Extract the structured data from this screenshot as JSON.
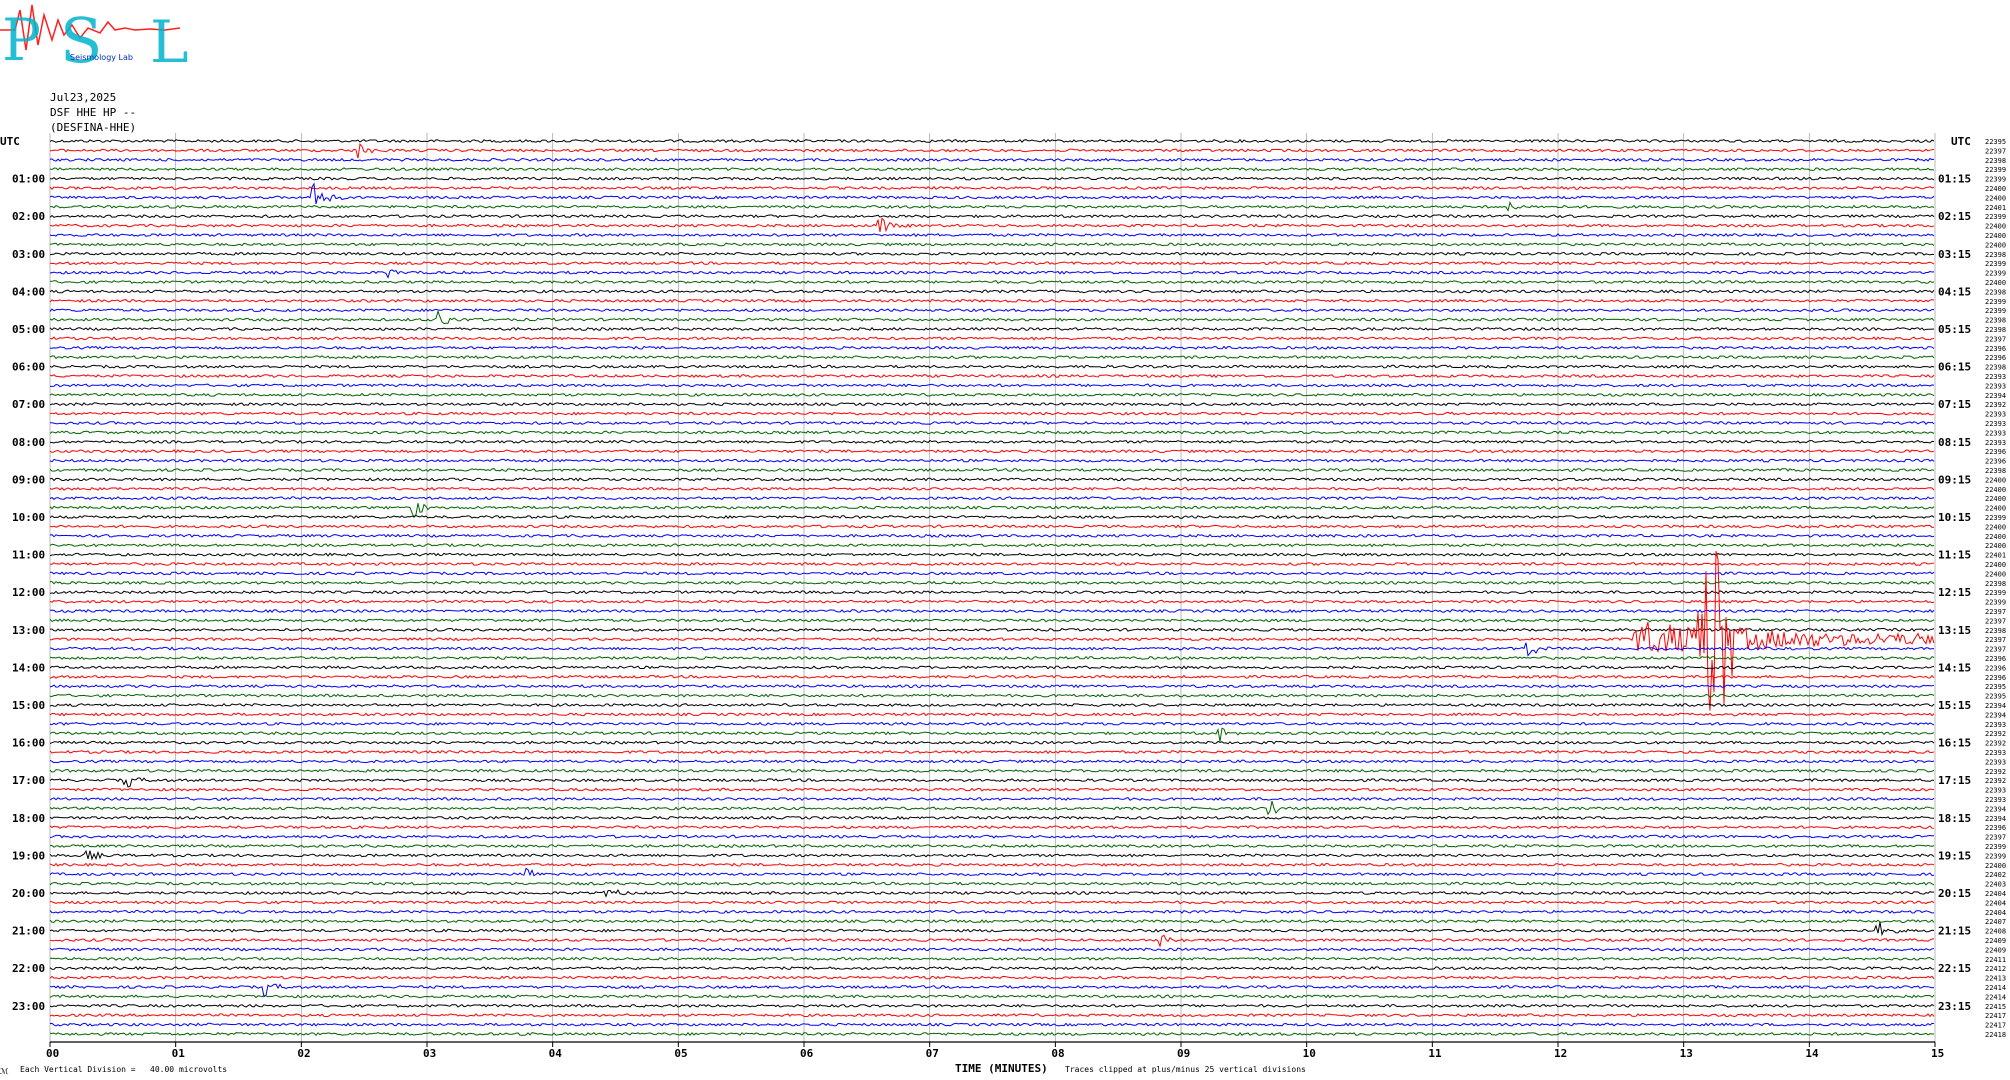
{
  "logo": {
    "letters": [
      "P",
      "S",
      "L"
    ],
    "subtitle": "Seismology Lab"
  },
  "header": {
    "date": "Jul23,2025",
    "channel": "DSF HHE HP --",
    "station": "(DESFINA-HHE)"
  },
  "chart_data": {
    "type": "line",
    "title": "Jul23,2025",
    "xlabel": "TIME (MINUTES)",
    "ylabel": "UTC",
    "xlim": [
      0,
      15
    ],
    "x_ticks": [
      "00",
      "01",
      "02",
      "03",
      "04",
      "05",
      "06",
      "07",
      "08",
      "09",
      "10",
      "11",
      "12",
      "13",
      "14",
      "15"
    ],
    "left_axis_label": "UTC",
    "right_axis_label": "UTC",
    "left_hour_labels": [
      "01:00",
      "02:00",
      "03:00",
      "04:00",
      "05:00",
      "06:00",
      "07:00",
      "08:00",
      "09:00",
      "10:00",
      "11:00",
      "12:00",
      "13:00",
      "14:00",
      "15:00",
      "16:00",
      "17:00",
      "18:00",
      "19:00",
      "20:00",
      "21:00",
      "22:00",
      "23:00"
    ],
    "right_hour_labels": [
      "01:15",
      "02:15",
      "03:15",
      "04:15",
      "05:15",
      "06:15",
      "07:15",
      "08:15",
      "09:15",
      "10:15",
      "11:15",
      "12:15",
      "13:15",
      "14:15",
      "15:15",
      "16:15",
      "17:15",
      "18:15",
      "19:15",
      "20:15",
      "21:15",
      "22:15",
      "23:15"
    ],
    "trace_colors": [
      "#000000",
      "#ff0000",
      "#0000ff",
      "#006400"
    ],
    "trace_count": 96,
    "right_values": [
      "22395",
      "22397",
      "22398",
      "22399",
      "22399",
      "22400",
      "22400",
      "22401",
      "22399",
      "22400",
      "22400",
      "22400",
      "22398",
      "22399",
      "22399",
      "22400",
      "22398",
      "22399",
      "22399",
      "22398",
      "22398",
      "22397",
      "22396",
      "22396",
      "22398",
      "22393",
      "22393",
      "22394",
      "22392",
      "22393",
      "22393",
      "22393",
      "22393",
      "22396",
      "22396",
      "22398",
      "22400",
      "22400",
      "22400",
      "22400",
      "22399",
      "22400",
      "22400",
      "22400",
      "22401",
      "22400",
      "22400",
      "22398",
      "22399",
      "22399",
      "22397",
      "22397",
      "22398",
      "22397",
      "22397",
      "22396",
      "22396",
      "22396",
      "22395",
      "22395",
      "22394",
      "22394",
      "22393",
      "22392",
      "22392",
      "22393",
      "22393",
      "22392",
      "22392",
      "22393",
      "22393",
      "22394",
      "22394",
      "22396",
      "22397",
      "22399",
      "22399",
      "22400",
      "22402",
      "22403",
      "22404",
      "22404",
      "22404",
      "22407",
      "22408",
      "22409",
      "22409",
      "22411",
      "22412",
      "22413",
      "22414",
      "22414",
      "22415",
      "22417",
      "22417",
      "22418"
    ],
    "events": [
      {
        "trace": 1,
        "minute": 2.45,
        "amp": 1.2
      },
      {
        "trace": 6,
        "minute": 2.1,
        "amp": 2.5
      },
      {
        "trace": 7,
        "minute": 11.6,
        "amp": 0.8
      },
      {
        "trace": 9,
        "minute": 6.6,
        "amp": 1.3
      },
      {
        "trace": 14,
        "minute": 2.7,
        "amp": 0.6
      },
      {
        "trace": 19,
        "minute": 3.1,
        "amp": 1.6
      },
      {
        "trace": 39,
        "minute": 2.9,
        "amp": 1.4
      },
      {
        "trace": 54,
        "minute": 11.75,
        "amp": 1.5
      },
      {
        "trace": 63,
        "minute": 9.3,
        "amp": 1.4
      },
      {
        "trace": 68,
        "minute": 0.6,
        "amp": 1.2
      },
      {
        "trace": 71,
        "minute": 9.7,
        "amp": 1.6
      },
      {
        "trace": 76,
        "minute": 0.3,
        "amp": 0.8
      },
      {
        "trace": 78,
        "minute": 3.8,
        "amp": 0.8
      },
      {
        "trace": 80,
        "minute": 4.4,
        "amp": 1.3
      },
      {
        "trace": 84,
        "minute": 14.55,
        "amp": 1.2
      },
      {
        "trace": 85,
        "minute": 8.85,
        "amp": 0.8
      },
      {
        "trace": 90,
        "minute": 1.7,
        "amp": 1.3
      }
    ],
    "main_event": {
      "trace": 53,
      "start_minute": 12.6,
      "peak_minute": 13.25,
      "color": "#ff0000"
    },
    "clip_divisions": 25
  },
  "footer": {
    "scale_note": "Each Vertical Division =   40.00 microvolts",
    "clip_note": "Traces clipped at plus/minus 25 vertical divisions",
    "corner_mark": "ℳ"
  }
}
